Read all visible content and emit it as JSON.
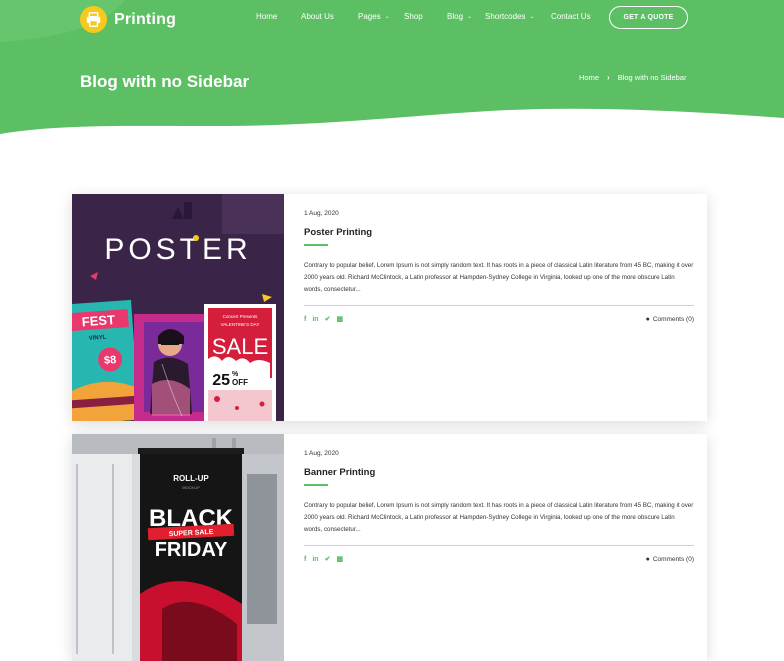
{
  "brand": {
    "name": "Printing"
  },
  "nav": {
    "items": [
      {
        "label": "Home",
        "has_dropdown": false
      },
      {
        "label": "About Us",
        "has_dropdown": false
      },
      {
        "label": "Pages",
        "has_dropdown": true
      },
      {
        "label": "Shop",
        "has_dropdown": false
      },
      {
        "label": "Blog",
        "has_dropdown": true
      },
      {
        "label": "Shortcodes",
        "has_dropdown": true
      },
      {
        "label": "Contact Us",
        "has_dropdown": false
      }
    ],
    "cta_label": "GET A QUOTE"
  },
  "header": {
    "title": "Blog with no Sidebar",
    "breadcrumb": [
      "Home",
      "Blog with no Sidebar"
    ]
  },
  "posts": [
    {
      "date": "1 Aug, 2020",
      "title": "Poster Printing",
      "excerpt": "Contrary to popular belief, Lorem Ipsum is not simply random text. It has roots in a piece of classical Latin literature from 45 BC, making it over 2000 years old. Richard McClintock, a Latin professor at Hampden-Sydney College in Virginia, looked up one of the more obscure Latin words, consectetur...",
      "comments": "Comments (0)",
      "image": {
        "headline": "POSTER",
        "fest": "FEST",
        "vinyl": "VINYL",
        "price": "$8",
        "concert": "Concert Presents",
        "valentine": "VALENTINE'S DAY",
        "sale": "SALE",
        "discount": "25",
        "off": "OFF",
        "pct": "%"
      }
    },
    {
      "date": "1 Aug, 2020",
      "title": "Banner Printing",
      "excerpt": "Contrary to popular belief, Lorem Ipsum is not simply random text. It has roots in a piece of classical Latin literature from 45 BC, making it over 2000 years old. Richard McClintock, a Latin professor at Hampden-Sydney College in Virginia, looked up one of the more obscure Latin words, consectetur...",
      "comments": "Comments (0)",
      "image": {
        "roll": "ROLL-UP",
        "mockup": "MOCKUP",
        "black": "BLACK",
        "super_sale": "SUPER SALE",
        "friday": "FRIDAY"
      }
    }
  ],
  "colors": {
    "primary_green": "#5cbf63",
    "logo_yellow": "#f5c91d",
    "text_dark": "#222222"
  },
  "icons": {
    "share": [
      "facebook-icon",
      "linkedin-icon",
      "twitter-icon",
      "share-more-icon"
    ],
    "comments": "comment-icon"
  }
}
